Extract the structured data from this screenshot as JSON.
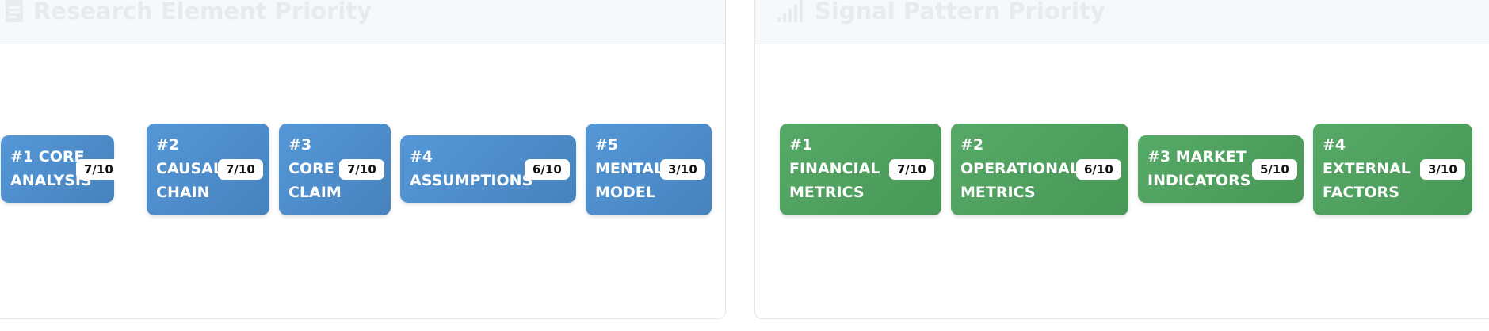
{
  "panels": {
    "research": {
      "title": "Research Element Priority",
      "icon": "document-icon",
      "accent": "#4f8fcf",
      "chips": [
        {
          "lines": [
            "#1 CORE",
            "ANALYSIS"
          ],
          "score": "7/10"
        },
        {
          "lines": [
            "#2",
            "CAUSAL",
            "CHAIN"
          ],
          "score": "7/10"
        },
        {
          "lines": [
            "#3",
            "CORE",
            "CLAIM"
          ],
          "score": "7/10"
        },
        {
          "lines": [
            "#4",
            "ASSUMPTIONS"
          ],
          "score": "6/10"
        },
        {
          "lines": [
            "#5",
            "MENTAL",
            "MODEL"
          ],
          "score": "3/10"
        }
      ]
    },
    "signal": {
      "title": "Signal Pattern Priority",
      "icon": "signal-bars-icon",
      "accent": "#52a262",
      "chips": [
        {
          "lines": [
            "#1",
            "FINANCIAL",
            "METRICS"
          ],
          "score": "7/10"
        },
        {
          "lines": [
            "#2",
            "OPERATIONAL",
            "METRICS"
          ],
          "score": "6/10"
        },
        {
          "lines": [
            "#3 MARKET",
            "INDICATORS"
          ],
          "score": "5/10"
        },
        {
          "lines": [
            "#4",
            "EXTERNAL",
            "FACTORS"
          ],
          "score": "3/10"
        }
      ]
    }
  }
}
